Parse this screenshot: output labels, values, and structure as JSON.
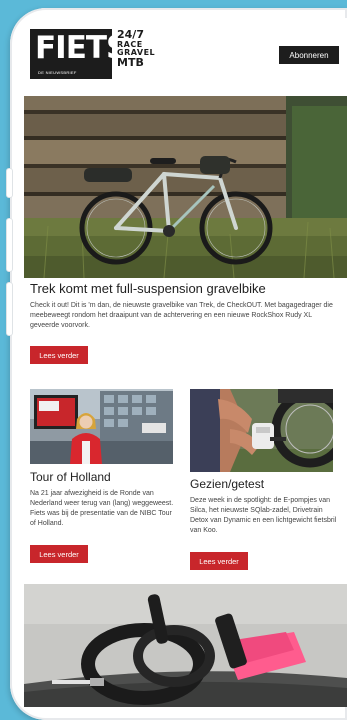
{
  "brand": {
    "name": "FIETS",
    "tagline": "DE NIEUWSBRIEF",
    "tags": [
      "24/7",
      "RACE",
      "GRAVEL",
      "MTB"
    ]
  },
  "header": {
    "subscribe_label": "Abonneren"
  },
  "hero": {
    "title": "Trek komt met full-suspension gravelbike",
    "text": "Check it out! Dit is 'm dan, de nieuwste gravelbike van Trek, de CheckOUT. Met bagagedrager die meebeweegt rondom het draaipunt van de achtervering en een nieuwe RockShox Rudy XL geveerde voorvork.",
    "button": "Lees verder"
  },
  "cards": [
    {
      "title": "Tour of Holland",
      "text": "Na 21 jaar afwezigheid is de Ronde van Nederland weer terug van (lang) weggeweest. Fiets was bij de presentatie van de NIBC Tour of Holland.",
      "button": "Lees verder"
    },
    {
      "title": "Gezien/getest",
      "text": "Deze week in de spotlight: de E-pompjes van Silca, het nieuwste SQlab-zadel, Drivetrain Detox van Dynamic en een lichtgewicht fietsbril van Koo.",
      "button": "Lees verder"
    }
  ],
  "colors": {
    "accent": "#c8262b",
    "background": "#5bb9d8",
    "dark": "#1c1c1c"
  }
}
